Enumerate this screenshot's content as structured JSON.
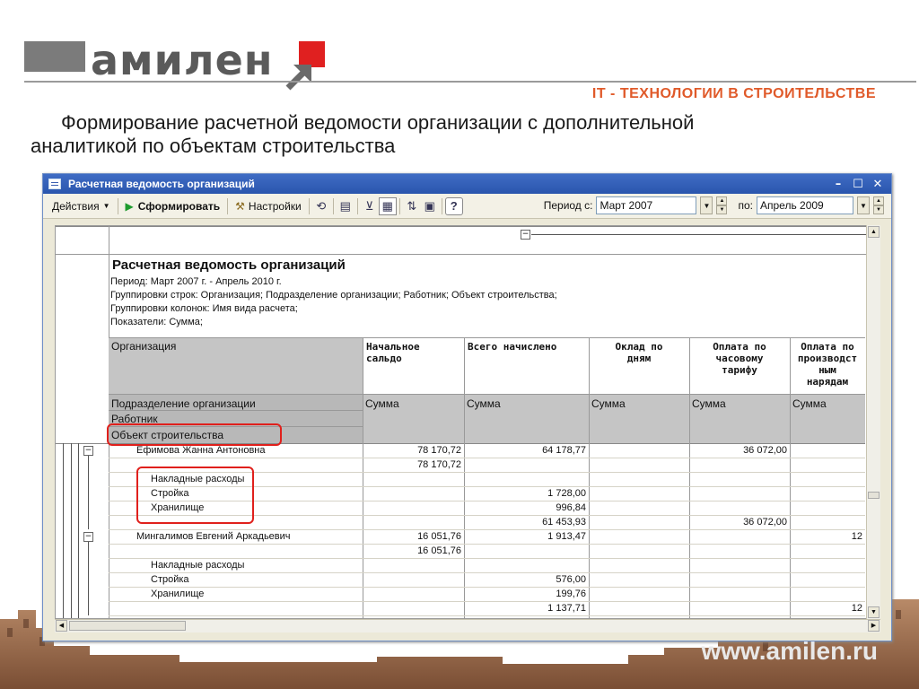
{
  "brand": {
    "name": "амилен",
    "slogan": "IT - ТЕХНОЛОГИИ В СТРОИТЕЛЬСТВЕ",
    "website": "www.amilen.ru",
    "accent": "#e02020",
    "slogan_color": "#e05a2a"
  },
  "slide": {
    "title_line1": "Формирование расчетной ведомости организации с дополнительной",
    "title_line2": "аналитикой по объектам строительства"
  },
  "window": {
    "title": "Расчетная ведомость организаций",
    "toolbar": {
      "actions": "Действия",
      "run": "Сформировать",
      "settings": "Настройки",
      "period_from_label": "Период с:",
      "period_from": "Март 2007",
      "period_to_label": "по:",
      "period_to": "Апрель 2009"
    }
  },
  "report": {
    "title": "Расчетная ведомость организаций",
    "info": [
      "Период: Март 2007 г. - Апрель 2010 г.",
      "Группировки строк: Организация; Подразделение организации; Работник; Объект строительства;",
      "Группировки колонок: Имя вида расчета;",
      "Показатели: Сумма;"
    ],
    "row_headers": [
      "Организация",
      "Подразделение организации",
      "Работник",
      "Объект строительства"
    ],
    "columns": [
      "Начальное сальдо",
      "Всего начислено",
      "Оклад по дням",
      "Оплата по часовому тарифу",
      "Оплата по производственным нарядам"
    ],
    "column_headers_display": [
      [
        "Начальное",
        "сальдо"
      ],
      [
        "Всего начислено"
      ],
      [
        "Оклад по",
        "дням"
      ],
      [
        "Оплата по",
        "часовому",
        "тарифу"
      ],
      [
        "Оплата по",
        "производст",
        "ным",
        "нарядам"
      ]
    ],
    "measure": "Сумма",
    "rows": [
      {
        "label": "Ефимова Жанна Антоновна",
        "level": "employee",
        "v": [
          "78 170,72",
          "64 178,77",
          "",
          "36 072,00",
          ""
        ]
      },
      {
        "label": "",
        "level": "sub",
        "v": [
          "78 170,72",
          "",
          "",
          "",
          ""
        ]
      },
      {
        "label": "Накладные расходы",
        "level": "object",
        "v": [
          "",
          "",
          "",
          "",
          ""
        ]
      },
      {
        "label": "Стройка",
        "level": "object",
        "v": [
          "",
          "1 728,00",
          "",
          "",
          ""
        ]
      },
      {
        "label": "Хранилище",
        "level": "object",
        "v": [
          "",
          "996,84",
          "",
          "",
          ""
        ]
      },
      {
        "label": "",
        "level": "sub",
        "v": [
          "",
          "61 453,93",
          "",
          "36 072,00",
          ""
        ]
      },
      {
        "label": "Мингалимов Евгений Аркадьевич",
        "level": "employee",
        "v": [
          "16 051,76",
          "1 913,47",
          "",
          "",
          "12"
        ]
      },
      {
        "label": "",
        "level": "sub",
        "v": [
          "16 051,76",
          "",
          "",
          "",
          ""
        ]
      },
      {
        "label": "Накладные расходы",
        "level": "object",
        "v": [
          "",
          "",
          "",
          "",
          ""
        ]
      },
      {
        "label": "Стройка",
        "level": "object",
        "v": [
          "",
          "576,00",
          "",
          "",
          ""
        ]
      },
      {
        "label": "Хранилище",
        "level": "object",
        "v": [
          "",
          "199,76",
          "",
          "",
          ""
        ]
      },
      {
        "label": "",
        "level": "sub",
        "v": [
          "",
          "1 137,71",
          "",
          "",
          "12"
        ]
      }
    ]
  }
}
